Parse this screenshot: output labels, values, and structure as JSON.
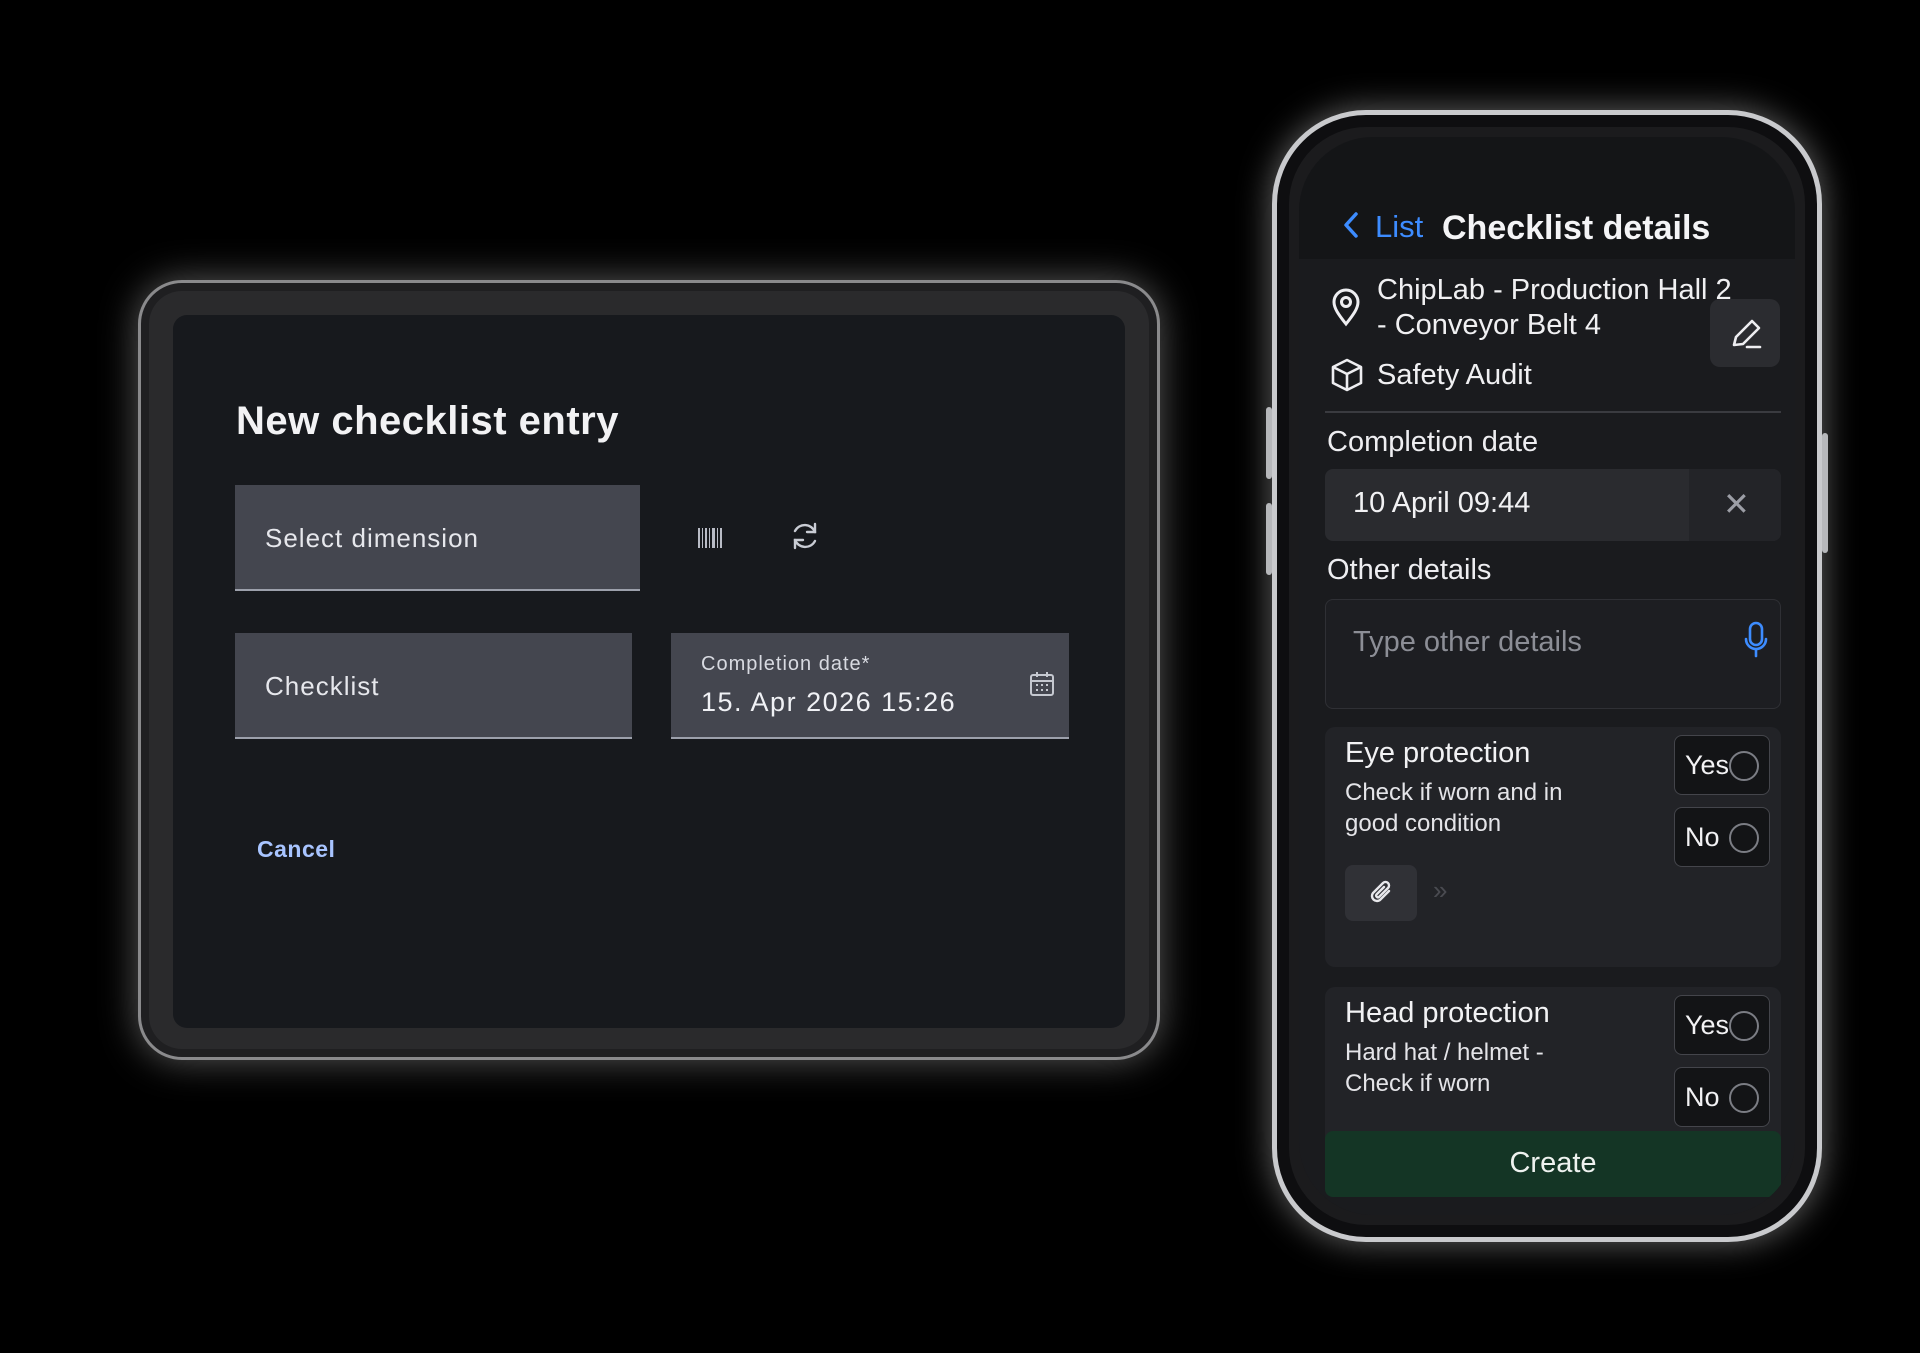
{
  "tablet": {
    "title": "New checklist entry",
    "select_dimension_placeholder": "Select dimension",
    "checklist_placeholder": "Checklist",
    "completion_date_label": "Completion date*",
    "completion_date_value": "15. Apr 2026 15:26",
    "cancel_label": "Cancel",
    "icons": [
      "barcode-icon",
      "refresh-icon",
      "calendar-icon"
    ]
  },
  "phone": {
    "back_label": "List",
    "title": "Checklist details",
    "location": "ChipLab - Production Hall 2  - Conveyor Belt 4",
    "audit": "Safety Audit",
    "completion_date_label": "Completion date",
    "completion_date_value": "10 April 09:44",
    "clear_symbol": "✕",
    "other_details_label": "Other details",
    "other_details_placeholder": "Type other details",
    "items": [
      {
        "title": "Eye protection",
        "description": "Check if worn and in good condition",
        "yes_label": "Yes",
        "no_label": "No"
      },
      {
        "title": "Head protection",
        "description": "Hard hat / helmet - Check if worn",
        "yes_label": "Yes",
        "no_label": "No"
      }
    ],
    "more_symbol": "»",
    "create_label": "Create",
    "accent_color": "#3d8cff",
    "create_button_color": "#143525"
  }
}
